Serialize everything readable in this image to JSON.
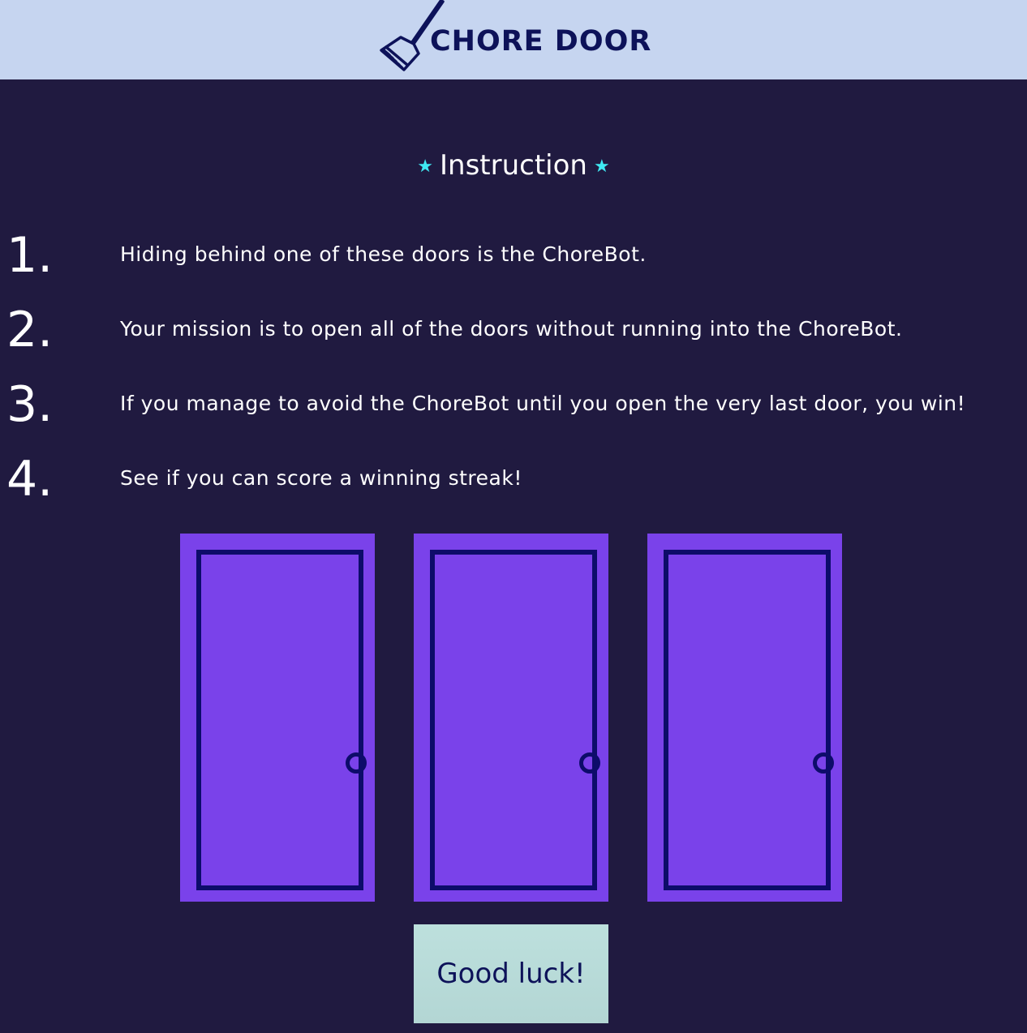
{
  "header": {
    "title": "CHORE DOOR",
    "logo_icon": "broom-icon",
    "background": "#c6d5f0",
    "title_color": "#0d1259"
  },
  "instructions": {
    "heading": "Instruction",
    "star_icon": "star-icon",
    "steps": [
      {
        "number": "1.",
        "text": "Hiding behind one of these doors is the ChoreBot."
      },
      {
        "number": "2.",
        "text": "Your mission is to open all of the doors without running into the ChoreBot."
      },
      {
        "number": "3.",
        "text": "If you manage to avoid the ChoreBot until you open the very last door, you win!"
      },
      {
        "number": "4.",
        "text": "See if you can score a winning streak!"
      }
    ]
  },
  "doors": [
    {
      "state": "closed"
    },
    {
      "state": "closed"
    },
    {
      "state": "closed"
    }
  ],
  "start_button": {
    "label": "Good luck!"
  },
  "colors": {
    "page_background": "#201a40",
    "door": "#7a42ea",
    "door_outline": "#0d0c6a",
    "star": "#3fe9f2",
    "button": "#b8dcda"
  }
}
